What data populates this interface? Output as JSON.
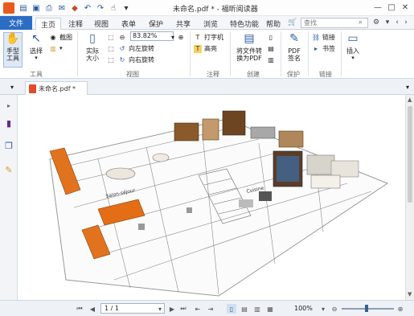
{
  "window": {
    "title": "未命名.pdf * - 福昕阅读器",
    "controls": [
      "minimize-icon",
      "maximize-icon",
      "close-icon"
    ]
  },
  "quick_access": [
    "app-logo-icon",
    "save-icon",
    "print-icon",
    "open-icon",
    "email-icon",
    "undo-icon",
    "redo-icon",
    "hand-cursor-icon",
    "more-icon"
  ],
  "menu": {
    "file": "文件",
    "tabs": [
      "主页",
      "注释",
      "视图",
      "表单",
      "保护",
      "共享",
      "浏览",
      "特色功能",
      "帮助"
    ],
    "active_tab": "主页",
    "search_placeholder": "查找"
  },
  "ribbon": {
    "tools_group": {
      "label": "工具",
      "hand": "手型工具",
      "select": "选择",
      "snapshot": "截图"
    },
    "view_group": {
      "label": "视图",
      "actual_size": "实际大小",
      "zoom_value": "83.82%",
      "rotate_left": "向左旋转",
      "rotate_right": "向右旋转"
    },
    "comment_group": {
      "label": "注释",
      "typewriter": "打字机",
      "highlight": "高亮"
    },
    "create_group": {
      "label": "创建",
      "convert": "将文件转换为PDF"
    },
    "protect_group": {
      "label": "保护",
      "sign": "PDF签名"
    },
    "link_group": {
      "label": "链接",
      "link": "链接",
      "bookmark": "书签"
    },
    "insert_group": {
      "insert": "插入"
    }
  },
  "document": {
    "tab_label": "未命名.pdf *"
  },
  "status": {
    "page": "1 / 1",
    "zoom": "100%"
  }
}
